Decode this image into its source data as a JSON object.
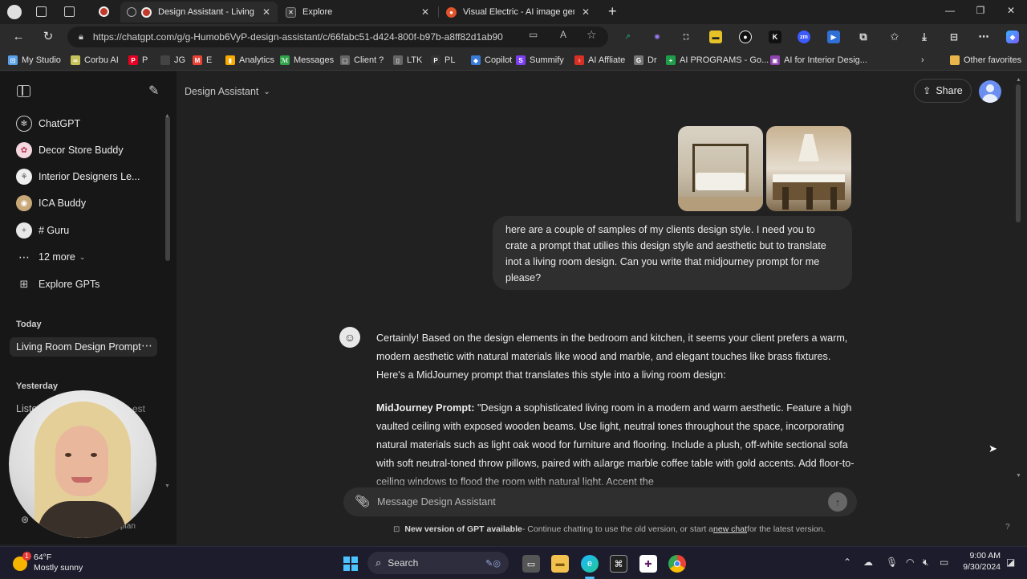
{
  "browser": {
    "tabs": [
      {
        "title": "Design Assistant - Living Roo",
        "active": true
      },
      {
        "title": "Explore",
        "active": false
      },
      {
        "title": "Visual Electric - AI image generat",
        "active": false
      }
    ],
    "new_tab": "+",
    "url": "https://chatgpt.com/g/g-Humob6VyP-design-assistant/c/66fabc51-d424-800f-b97b-a8ff82d1ab90",
    "bookmarks": [
      {
        "label": "My Studio",
        "color": "#5aa0e8",
        "glyph": "⊡"
      },
      {
        "label": "Corbu AI",
        "color": "#c6c35a",
        "glyph": "∞"
      },
      {
        "label": "P",
        "color": "#e60023",
        "glyph": "P"
      },
      {
        "label": "JG",
        "color": "#444444",
        "glyph": ""
      },
      {
        "label": "E",
        "color": "#ea4335",
        "glyph": "M"
      },
      {
        "label": "Analytics",
        "color": "#f9ab00",
        "glyph": "▮"
      },
      {
        "label": "Messages",
        "color": "#2fa24a",
        "glyph": "ℳ"
      },
      {
        "label": "Client ?",
        "color": "#666666",
        "glyph": "▢"
      },
      {
        "label": "LTK",
        "color": "#666666",
        "glyph": "▯"
      },
      {
        "label": "PL",
        "color": "#333333",
        "glyph": "P"
      },
      {
        "label": "Copilot",
        "color": "#3a7bd5",
        "glyph": "◆"
      },
      {
        "label": "Summify",
        "color": "#7b3ff2",
        "glyph": "S"
      },
      {
        "label": "AI Affliate",
        "color": "#d93025",
        "glyph": "♀"
      },
      {
        "label": "Dr",
        "color": "#777777",
        "glyph": "G"
      },
      {
        "label": "AI PROGRAMS - Go...",
        "color": "#1e9e4a",
        "glyph": "+"
      },
      {
        "label": "AI for Interior Desig...",
        "color": "#8e44ad",
        "glyph": "▣"
      }
    ],
    "other_favorites": "Other favorites"
  },
  "sidebar": {
    "items": [
      {
        "label": "ChatGPT",
        "icon": "openai-icon"
      },
      {
        "label": "Decor Store Buddy",
        "icon": "gpt-avatar"
      },
      {
        "label": "Interior Designers Le...",
        "icon": "gpt-avatar"
      },
      {
        "label": "ICA Buddy",
        "icon": "gpt-avatar"
      },
      {
        "label": "# Guru",
        "icon": "gpt-avatar"
      },
      {
        "label": "12 more",
        "icon": "ellipsis-icon"
      },
      {
        "label": "Explore GPTs",
        "icon": "grid-icon"
      }
    ],
    "today_label": "Today",
    "today_chat": "Living Room Design Prompt",
    "yesterday_label": "Yesterday",
    "yesterday_chat_partial": "Liste",
    "yesterday_chat_tail": "est",
    "bottom_partial": "plan"
  },
  "main": {
    "model_name": "Design Assistant",
    "share_label": "Share",
    "user_message": "here are a couple of samples of my clients design style. I need you to crate a prompt that utilies this design style and aesthetic but to translate inot a living room design. Can you write that midjourney prompt for me please?",
    "assistant_intro": "Certainly! Based on the design elements in the bedroom and kitchen, it seems your client prefers a warm, modern aesthetic with natural materials like wood and marble, and elegant touches like brass fixtures. Here's a MidJourney prompt that translates this style into a living room design:",
    "prompt_label": "MidJourney Prompt:",
    "prompt_text": " \"Design a sophisticated living room in a modern and warm aesthetic. Feature a high vaulted ceiling with exposed wooden beams. Use light, neutral tones throughout the space, incorporating natural materials such as light oak wood for furniture and flooring. Include a plush, off-white sectional sofa with soft neutral-toned throw pillows, paired with a large marble coffee table with gold accents. Add floor-to-ceiling windows to flood the room with natural light. Accent the",
    "composer_placeholder": "Message Design Assistant",
    "notice_bold": "New version of GPT available",
    "notice_text": " - Continue chatting to use the old version, or start a ",
    "notice_link": "new chat",
    "notice_tail": " for the latest version.",
    "help": "?"
  },
  "taskbar": {
    "weather_temp": "64°F",
    "weather_desc": "Mostly sunny",
    "weather_badge": "1",
    "search_label": "Search",
    "time": "9:00 AM",
    "date": "9/30/2024"
  }
}
